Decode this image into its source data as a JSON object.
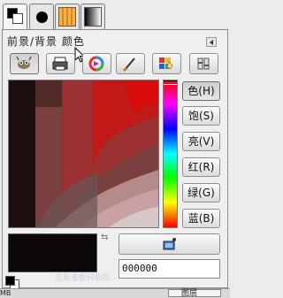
{
  "dialog": {
    "title": "前景/背景 颜色"
  },
  "tabs": [
    {
      "name": "fg-bg-tab",
      "active": true
    },
    {
      "name": "brush-tab",
      "active": false
    },
    {
      "name": "pattern-tab",
      "active": false
    },
    {
      "name": "gradient-tab",
      "active": false
    }
  ],
  "selector_buttons": [
    {
      "name": "gimp-selector-button",
      "icon": "wilber-icon",
      "active": true
    },
    {
      "name": "cmyk-selector-button",
      "icon": "printer-icon",
      "active": false
    },
    {
      "name": "wheel-selector-button",
      "icon": "color-wheel-icon",
      "active": false
    },
    {
      "name": "watercolor-selector-button",
      "icon": "brush-icon",
      "active": false
    },
    {
      "name": "palette-selector-button",
      "icon": "palette-icon",
      "active": false
    },
    {
      "name": "scales-selector-button",
      "icon": "scales-icon",
      "active": false
    }
  ],
  "channels": [
    {
      "label": "色(H)",
      "active": true
    },
    {
      "label": "饱(S)",
      "active": false
    },
    {
      "label": "亮(V)",
      "active": false
    },
    {
      "label": "红(R)",
      "active": false
    },
    {
      "label": "绿(G)",
      "active": false
    },
    {
      "label": "蓝(B)",
      "active": false
    }
  ],
  "current_color": {
    "hex": "000000",
    "fg": "#0d0808",
    "bg": "#ffffff"
  },
  "watermark": "志愿者数码影院",
  "bottom": {
    "left_text": "MB",
    "tab_label": "图层"
  }
}
